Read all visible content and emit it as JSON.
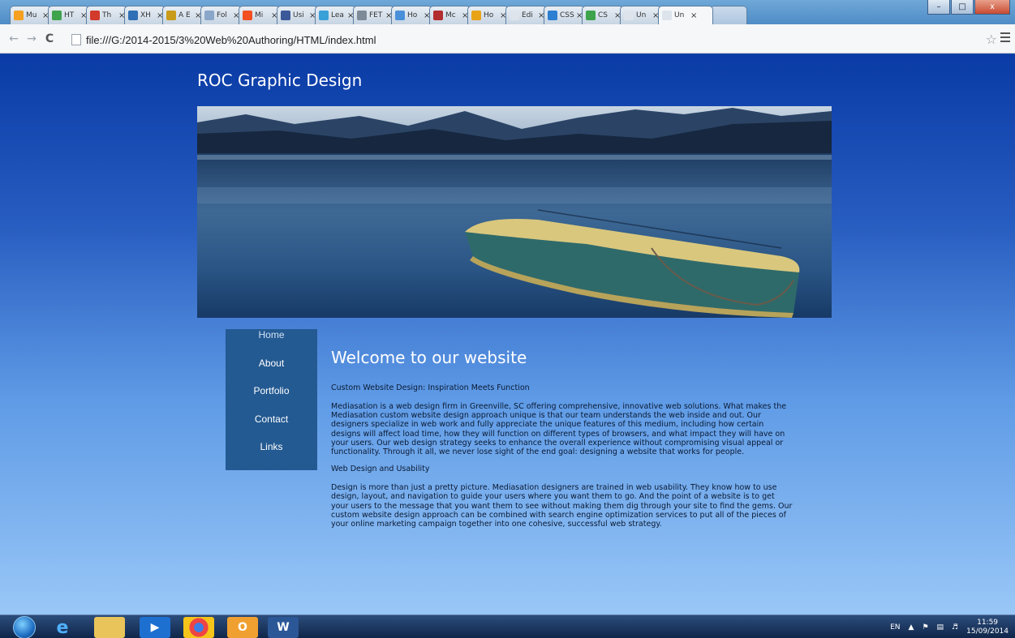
{
  "browser": {
    "tabs": [
      {
        "label": "Mu",
        "color": "#f5a020"
      },
      {
        "label": "HT",
        "color": "#3fa34d"
      },
      {
        "label": "Th",
        "color": "#d23a2c"
      },
      {
        "label": "XH",
        "color": "#2f6fb5"
      },
      {
        "label": "A E",
        "color": "#c89b1a"
      },
      {
        "label": "Fol",
        "color": "#8aa7c9"
      },
      {
        "label": "Mi",
        "color": "#f25022"
      },
      {
        "label": "Usi",
        "color": "#3b5998"
      },
      {
        "label": "Lea",
        "color": "#3aa0d8"
      },
      {
        "label": "FET",
        "color": "#7d8b99"
      },
      {
        "label": "Ho",
        "color": "#4a90d9"
      },
      {
        "label": "Mc",
        "color": "#b32e2e"
      },
      {
        "label": "Ho",
        "color": "#e8a317"
      },
      {
        "label": "Edi",
        "color": "#dde4ec"
      },
      {
        "label": "CSS",
        "color": "#2c7fd1"
      },
      {
        "label": "CS",
        "color": "#3fa34d"
      },
      {
        "label": "Un",
        "color": "#dde4ec"
      },
      {
        "label": "Un",
        "color": "#dde4ec",
        "active": true
      }
    ],
    "url": "file:///G:/2014-2015/3%20Web%20Authoring/HTML/index.html",
    "window_buttons": {
      "minimize": "–",
      "maximize": "□",
      "close": "x"
    }
  },
  "site": {
    "title": "ROC Graphic Design",
    "nav": [
      "Home",
      "About",
      "Portfolio",
      "Contact",
      "Links"
    ],
    "heading": "Welcome to our website",
    "sub1": "Custom Website Design: Inspiration Meets Function",
    "para1": "Mediasation is a web design firm in Greenville, SC offering comprehensive, innovative web solutions. What makes the Mediasation custom website design approach unique is that our team understands the web inside and out. Our designers specialize in web work and fully appreciate the unique features of this medium, including how certain designs will affect load time, how they will function on different types of browsers, and what impact they will have on your users. Our web design strategy seeks to enhance the overall experience without compromising visual appeal or functionality. Through it all, we never lose sight of the end goal: designing a website that works for people.",
    "sub2": "Web Design and Usability",
    "para2": "Design is more than just a pretty picture. Mediasation designers are trained in web usability. They know how to use design, layout, and navigation to guide your users where you want them to go. And the point of a website is to get your users to the message that you want them to see without making them dig through your site to find the gems. Our custom website design approach can be combined with search engine optimization services to put all of the pieces of your online marketing campaign together into one cohesive, successful web strategy."
  },
  "taskbar": {
    "apps": [
      "ie-icon",
      "explorer-icon",
      "media-player-icon",
      "chrome-icon",
      "outlook-icon",
      "word-icon"
    ],
    "language": "EN",
    "time": "11:59",
    "date": "15/09/2014"
  }
}
